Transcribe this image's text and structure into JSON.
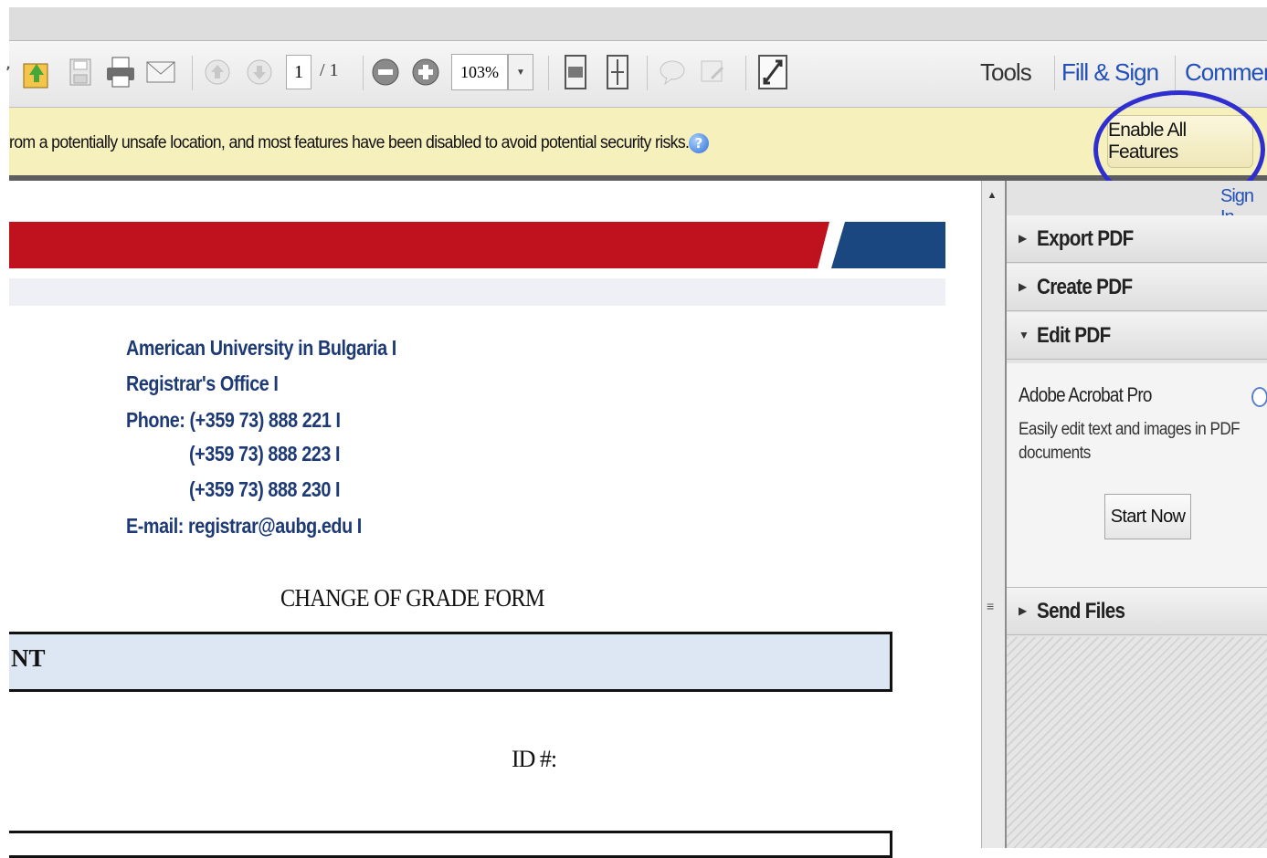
{
  "toolbar": {
    "page_current": "1",
    "page_total": "/ 1",
    "zoom": "103%",
    "links": {
      "tools": "Tools",
      "fill_sign": "Fill & Sign",
      "comment": "Comment"
    },
    "icons": [
      "open-file-icon",
      "save-icon",
      "print-icon",
      "email-icon",
      "page-up-icon",
      "page-down-icon",
      "zoom-out-icon",
      "zoom-in-icon",
      "fit-page-icon",
      "fit-width-icon",
      "comment-bubble-icon",
      "sticky-note-icon",
      "fullscreen-icon"
    ]
  },
  "security_bar": {
    "message": "rom a potentially unsafe location, and most features have been disabled to avoid potential security risks.",
    "help_glyph": "?",
    "button": "Enable All Features"
  },
  "document": {
    "contact": {
      "line1": "American University in Bulgaria I",
      "line2": "Registrar's Office I",
      "line3": "Phone: (+359 73) 888 221 I",
      "line4": "(+359 73) 888 223 I",
      "line5": "(+359 73) 888 230 I",
      "line6": "E-mail: registrar@aubg.edu I"
    },
    "form_title": "CHANGE OF GRADE FORM",
    "student_header": "NT",
    "id_label": "ID #:",
    "colors": {
      "red_band": "#c0111f",
      "blue_band": "#1a477f",
      "contact_text": "#1d3a75"
    }
  },
  "right_pane": {
    "sign_in": "Sign In",
    "sections": {
      "export": "Export PDF",
      "create": "Create PDF",
      "edit": "Edit PDF",
      "send": "Send Files"
    },
    "edit_panel": {
      "title": "Adobe Acrobat Pro",
      "description": "Easily edit text and images in PDF documents",
      "button": "Start Now"
    }
  }
}
